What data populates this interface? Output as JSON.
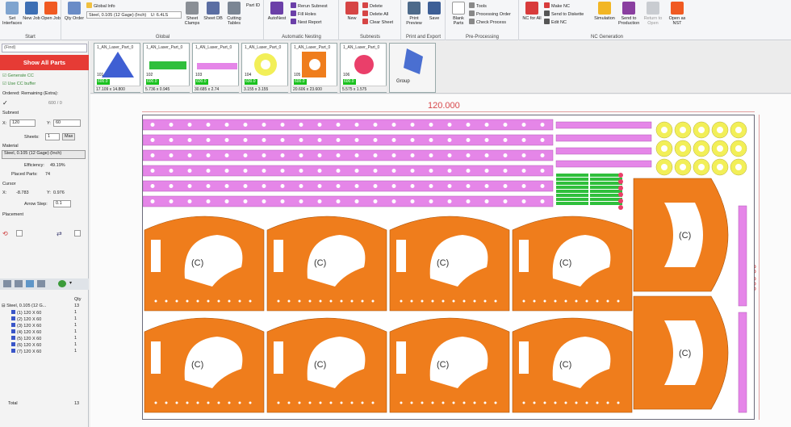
{
  "colors": {
    "ribbon_bg": "#f5f6f8",
    "accent_red": "#e63b35",
    "part_magenta": "#e586e8",
    "part_orange": "#ef7d1c",
    "part_yellow": "#f2ef58",
    "part_green": "#2fbf3c",
    "dimension_red": "#d7474a"
  },
  "ribbon": {
    "groups": [
      {
        "name": "start",
        "label": "Start"
      },
      {
        "name": "global",
        "label": "Global"
      },
      {
        "name": "auto-nesting",
        "label": "Automatic Nesting"
      },
      {
        "name": "subnests",
        "label": "Subnests"
      },
      {
        "name": "print-export",
        "label": "Print and Export"
      },
      {
        "name": "pre-processing",
        "label": "Pre-Processing"
      },
      {
        "name": "nc-generation",
        "label": "NC Generation"
      }
    ],
    "buttons": {
      "set_interfaces": "Set Interfaces",
      "new_job": "New Job",
      "open_job": "Open Job",
      "qty_order": "Qty Order",
      "global_info": "Global Info",
      "material_value": "Steel, 0.105 (12 Gage) (Inch)",
      "unit": "U: 6.4LS",
      "sheet_clamps": "Sheet Clamps",
      "sheet_db": "Sheet DB",
      "cutting_tables": "Cutting Tables",
      "part_id": "Part ID",
      "autonest": "AutoNest",
      "rerun_subnest": "Rerun Subnest",
      "fill_holes": "Fill Holes",
      "nest_report": "Nest Report",
      "new": "New",
      "delete": "Delete",
      "delete_all": "Delete All",
      "clear_sheet": "Clear Sheet",
      "print_preview": "Print Preview",
      "save": "Save",
      "blank_parts": "Blank Parts",
      "tools": "Tools",
      "processing_order": "Processing Order",
      "check_process": "Check Process",
      "nc_for_all": "NC for All",
      "make_nc": "Make NC",
      "send_to_diskette": "Send to Diskette",
      "edit_nc": "Edit NC",
      "simulation": "Simulation",
      "send_to_production": "Send to Production",
      "return_to_open": "Return to Open",
      "open_as_nst": "Open as NST"
    }
  },
  "left_panel": {
    "find_placeholder": "(Find)",
    "show_all_parts": "Show All Parts",
    "generate_cc": "Generate CC",
    "use_cc_buffer": "Use CC buffer",
    "ordered_remaining_label": "Ordered: Remaining (Extra):",
    "ordered_value": "600 / 0",
    "subnest_label": "Subnest",
    "x_label": "X:",
    "x_value": "120",
    "y_label": "Y:",
    "y_value": "60",
    "sheets_label": "Sheets:",
    "sheets_value": "1",
    "max_label": "Max",
    "material_label": "Material",
    "material_value": "Steel, 0.105 (12 Gage) (Inch)",
    "efficiency_label": "Efficiency:",
    "efficiency_value": "49.19%",
    "placed_label": "Placed Parts:",
    "placed_value": "74",
    "cursor_label": "Cursor",
    "cursor_x_label": "X:",
    "cursor_x": "-8.783",
    "cursor_y_label": "Y:",
    "cursor_y": "0.976",
    "arrow_step_label": "Arrow Step:",
    "arrow_step": "0.1",
    "placement_label": "Placement",
    "tree_header_qty": "Qty",
    "tree_root": "Steel, 0.105 (12 G...",
    "tree_root_qty": "13",
    "tree_items": [
      {
        "label": "(1) 120 X 60",
        "qty": "1"
      },
      {
        "label": "(2) 120 X 60",
        "qty": "1"
      },
      {
        "label": "(3) 120 X 60",
        "qty": "1"
      },
      {
        "label": "(4) 120 X 60",
        "qty": "1"
      },
      {
        "label": "(5) 120 X 60",
        "qty": "1"
      },
      {
        "label": "(6) 120 X 60",
        "qty": "1"
      },
      {
        "label": "(7) 120 X 60",
        "qty": "1"
      }
    ],
    "total_label": "Total",
    "total_qty": "13"
  },
  "thumbnails": [
    {
      "name": "1_AN_Laser_Part_0",
      "id": "101",
      "qty": "600.0",
      "dim": "17.109 x 14.800",
      "shape": "triangle"
    },
    {
      "name": "1_AN_Laser_Part_0",
      "id": "102",
      "qty": "600.0",
      "dim": "5.736 x 0.945",
      "shape": "bar"
    },
    {
      "name": "1_AN_Laser_Part_0",
      "id": "103",
      "qty": "600.0",
      "dim": "30.685 x 2.74",
      "shape": "strip"
    },
    {
      "name": "1_AN_Laser_Part_0",
      "id": "104",
      "qty": "600.0",
      "dim": "3.155 x 3.155",
      "shape": "ring"
    },
    {
      "name": "1_AN_Laser_Part_0",
      "id": "105",
      "qty": "600.0",
      "dim": "20.606 x 23.600",
      "shape": "panel"
    },
    {
      "name": "1_AN_Laser_Part_0",
      "id": "106",
      "qty": "600.0",
      "dim": "5.575 x 1.575",
      "shape": "disc"
    },
    {
      "name": "",
      "id": "",
      "qty": "",
      "dim": "Group",
      "shape": "group"
    }
  ],
  "sheet": {
    "width_label": "120.000",
    "height_label": "60.000",
    "part_tag": "(C)"
  }
}
